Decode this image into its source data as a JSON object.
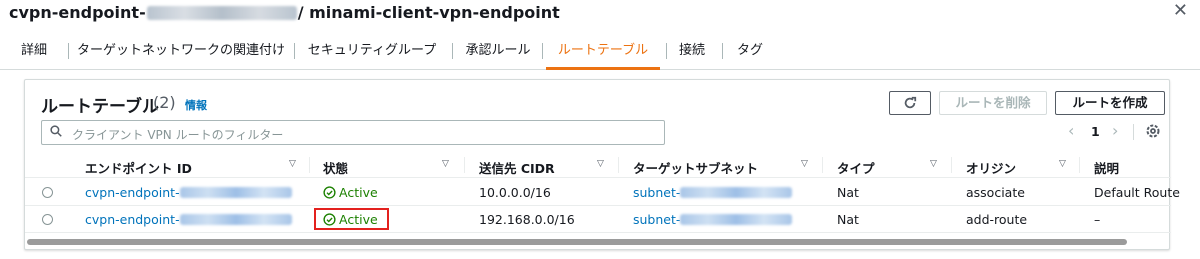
{
  "header": {
    "title_prefix": "cvpn-endpoint-",
    "title_suffix": "/ minami-client-vpn-endpoint",
    "close_label": "✕"
  },
  "tabs": [
    {
      "label": "詳細"
    },
    {
      "label": "ターゲットネットワークの関連付け"
    },
    {
      "label": "セキュリティグループ"
    },
    {
      "label": "承認ルール"
    },
    {
      "label": "ルートテーブル",
      "active": true
    },
    {
      "label": "接続"
    },
    {
      "label": "タグ"
    }
  ],
  "panel": {
    "title": "ルートテーブル",
    "count": "(2)",
    "info": "情報",
    "refresh_icon": "refresh-icon",
    "delete_button": "ルートを削除",
    "create_button": "ルートを作成"
  },
  "search": {
    "placeholder": "クライアント VPN ルートのフィルター"
  },
  "pagination": {
    "prev": "‹",
    "page": "1",
    "next": "›"
  },
  "table": {
    "columns": [
      "エンドポイント ID",
      "状態",
      "送信先 CIDR",
      "ターゲットサブネット",
      "タイプ",
      "オリジン",
      "説明"
    ],
    "rows": [
      {
        "endpoint": "cvpn-endpoint-",
        "status": "Active",
        "cidr": "10.0.0.0/16",
        "subnet": "subnet-",
        "type": "Nat",
        "origin": "associate",
        "description": "Default Route"
      },
      {
        "endpoint": "cvpn-endpoint-",
        "status": "Active",
        "cidr": "192.168.0.0/16",
        "subnet": "subnet-",
        "type": "Nat",
        "origin": "add-route",
        "description": "–"
      }
    ]
  },
  "colors": {
    "accent": "#ec7211",
    "link": "#0073bb",
    "status_active": "#1d8102",
    "highlight": "#e3211e"
  }
}
